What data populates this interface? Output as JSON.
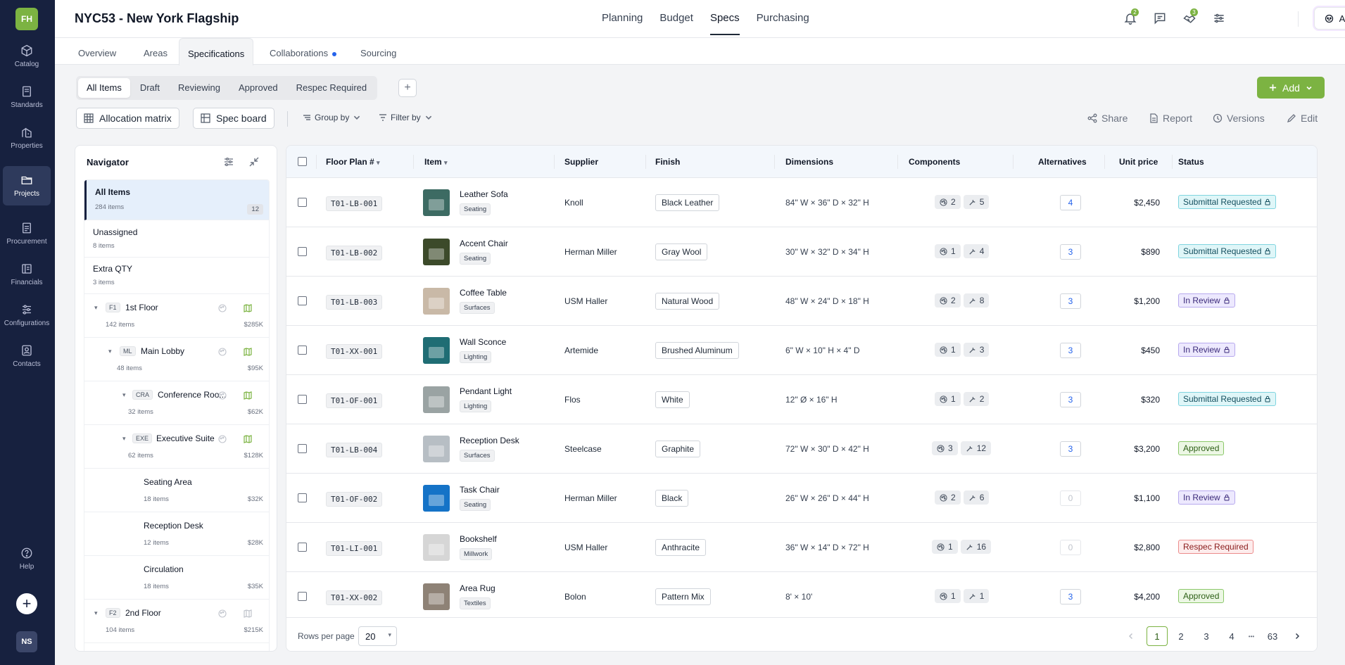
{
  "sidebar": {
    "logo": "FH",
    "items": [
      {
        "label": "Catalog",
        "icon": "cube-icon"
      },
      {
        "label": "Standards",
        "icon": "book-icon"
      },
      {
        "label": "Properties",
        "icon": "building-icon"
      },
      {
        "label": "Projects",
        "icon": "folder-icon",
        "active": true
      },
      {
        "label": "Procurement",
        "icon": "clipboard-icon"
      },
      {
        "label": "Financials",
        "icon": "ledger-icon"
      },
      {
        "label": "Configurations",
        "icon": "sliders-icon"
      },
      {
        "label": "Contacts",
        "icon": "contact-card-icon"
      }
    ],
    "help_label": "Help",
    "add_symbol": "+",
    "user_initials": "NS"
  },
  "header": {
    "project_title": "NYC53 - New York Flagship",
    "nav": [
      "Planning",
      "Budget",
      "Specs",
      "Purchasing"
    ],
    "active_nav": "Specs",
    "notifications_count": "2",
    "tasks_count": "3",
    "ask_label": "Ask Lio"
  },
  "subtabs": {
    "items": [
      "Overview",
      "Areas",
      "Specifications",
      "Collaborations",
      "Sourcing"
    ],
    "active": "Specifications"
  },
  "status_tabs": {
    "items": [
      "All Items",
      "Draft",
      "Reviewing",
      "Approved",
      "Respec Required"
    ],
    "active": "All Items",
    "add_symbol": "+"
  },
  "toolbar": {
    "allocation_matrix": "Allocation matrix",
    "spec_board": "Spec board",
    "group_by": "Group by",
    "filter_by": "Filter by",
    "share": "Share",
    "report": "Report",
    "versions": "Versions",
    "edit": "Edit",
    "add": "Add"
  },
  "navigator": {
    "title": "Navigator",
    "all_items": {
      "label": "All Items",
      "sub": "284 items",
      "count": "12"
    },
    "unassigned": {
      "label": "Unassigned",
      "sub": "8 items"
    },
    "extra_qty": {
      "label": "Extra QTY",
      "sub": "3 items"
    },
    "floor1": {
      "code": "F1",
      "label": "1st Floor",
      "sub": "142 items",
      "value": "$285K"
    },
    "main_lobby": {
      "code": "ML",
      "label": "Main Lobby",
      "sub": "48 items",
      "value": "$95K"
    },
    "conference": {
      "code": "CRA",
      "label": "Conference Roo...",
      "sub": "32 items",
      "value": "$62K"
    },
    "executive": {
      "code": "EXE",
      "label": "Executive Suite",
      "sub": "62 items",
      "value": "$128K"
    },
    "seating": {
      "label": "Seating Area",
      "sub": "18 items",
      "value": "$32K"
    },
    "reception": {
      "label": "Reception Desk",
      "sub": "12 items",
      "value": "$28K"
    },
    "circulation": {
      "label": "Circulation",
      "sub": "18 items",
      "value": "$35K"
    },
    "floor2": {
      "code": "F2",
      "label": "2nd Floor",
      "sub": "104 items",
      "value": "$215K"
    }
  },
  "table": {
    "headers": {
      "floor_plan": "Floor Plan #",
      "item": "Item",
      "supplier": "Supplier",
      "finish": "Finish",
      "dimensions": "Dimensions",
      "components": "Components",
      "alternatives": "Alternatives",
      "unit_price": "Unit price",
      "status": "Status"
    },
    "rows": [
      {
        "fp": "T01-LB-001",
        "name": "Leather Sofa",
        "category": "Seating",
        "supplier": "Knoll",
        "finish": "Black Leather",
        "dims": "84\" W × 36\" D × 32\" H",
        "comp_a": "2",
        "comp_b": "5",
        "alt": "4",
        "price": "$2,450",
        "status": "Submittal Requested",
        "status_type": "submittal",
        "thumb_color": "#3d6b63"
      },
      {
        "fp": "T01-LB-002",
        "name": "Accent Chair",
        "category": "Seating",
        "supplier": "Herman Miller",
        "finish": "Gray Wool",
        "dims": "30\" W × 32\" D × 34\" H",
        "comp_a": "1",
        "comp_b": "4",
        "alt": "3",
        "price": "$890",
        "status": "Submittal Requested",
        "status_type": "submittal",
        "thumb_color": "#3c4a2a"
      },
      {
        "fp": "T01-LB-003",
        "name": "Coffee Table",
        "category": "Surfaces",
        "supplier": "USM Haller",
        "finish": "Natural Wood",
        "dims": "48\" W × 24\" D × 18\" H",
        "comp_a": "2",
        "comp_b": "8",
        "alt": "3",
        "price": "$1,200",
        "status": "In Review",
        "status_type": "review",
        "thumb_color": "#c9b9a7"
      },
      {
        "fp": "T01-XX-001",
        "name": "Wall Sconce",
        "category": "Lighting",
        "supplier": "Artemide",
        "finish": "Brushed Aluminum",
        "dims": "6\" W × 10\" H × 4\" D",
        "comp_a": "1",
        "comp_b": "3",
        "alt": "3",
        "price": "$450",
        "status": "In Review",
        "status_type": "review",
        "thumb_color": "#1f6d74"
      },
      {
        "fp": "T01-OF-001",
        "name": "Pendant Light",
        "category": "Lighting",
        "supplier": "Flos",
        "finish": "White",
        "dims": "12\" Ø × 16\" H",
        "comp_a": "1",
        "comp_b": "2",
        "alt": "3",
        "price": "$320",
        "status": "Submittal Requested",
        "status_type": "submittal",
        "thumb_color": "#9aa3a3"
      },
      {
        "fp": "T01-LB-004",
        "name": "Reception Desk",
        "category": "Surfaces",
        "supplier": "Steelcase",
        "finish": "Graphite",
        "dims": "72\" W × 30\" D × 42\" H",
        "comp_a": "3",
        "comp_b": "12",
        "alt": "3",
        "price": "$3,200",
        "status": "Approved",
        "status_type": "approved",
        "thumb_color": "#b7bec4"
      },
      {
        "fp": "T01-OF-002",
        "name": "Task Chair",
        "category": "Seating",
        "supplier": "Herman Miller",
        "finish": "Black",
        "dims": "26\" W × 26\" D × 44\" H",
        "comp_a": "2",
        "comp_b": "6",
        "alt": "0",
        "price": "$1,100",
        "status": "In Review",
        "status_type": "review",
        "thumb_color": "#1573c7"
      },
      {
        "fp": "T01-LI-001",
        "name": "Bookshelf",
        "category": "Millwork",
        "supplier": "USM Haller",
        "finish": "Anthracite",
        "dims": "36\" W × 14\" D × 72\" H",
        "comp_a": "1",
        "comp_b": "16",
        "alt": "0",
        "price": "$2,800",
        "status": "Respec Required",
        "status_type": "respec",
        "thumb_color": "#d6d6d6"
      },
      {
        "fp": "T01-XX-002",
        "name": "Area Rug",
        "category": "Textiles",
        "supplier": "Bolon",
        "finish": "Pattern Mix",
        "dims": "8' × 10'",
        "comp_a": "1",
        "comp_b": "1",
        "alt": "3",
        "price": "$4,200",
        "status": "Approved",
        "status_type": "approved",
        "thumb_color": "#8e8276"
      }
    ]
  },
  "pagination": {
    "rows_per_page_label": "Rows per page",
    "rows_per_page": "20",
    "pages": [
      "1",
      "2",
      "3",
      "4"
    ],
    "ellipsis": "•••",
    "last_page": "63",
    "current": "1"
  },
  "colors": {
    "brand_green": "#7cb342",
    "sidebar_bg": "#17213f",
    "link_blue": "#2563eb"
  }
}
